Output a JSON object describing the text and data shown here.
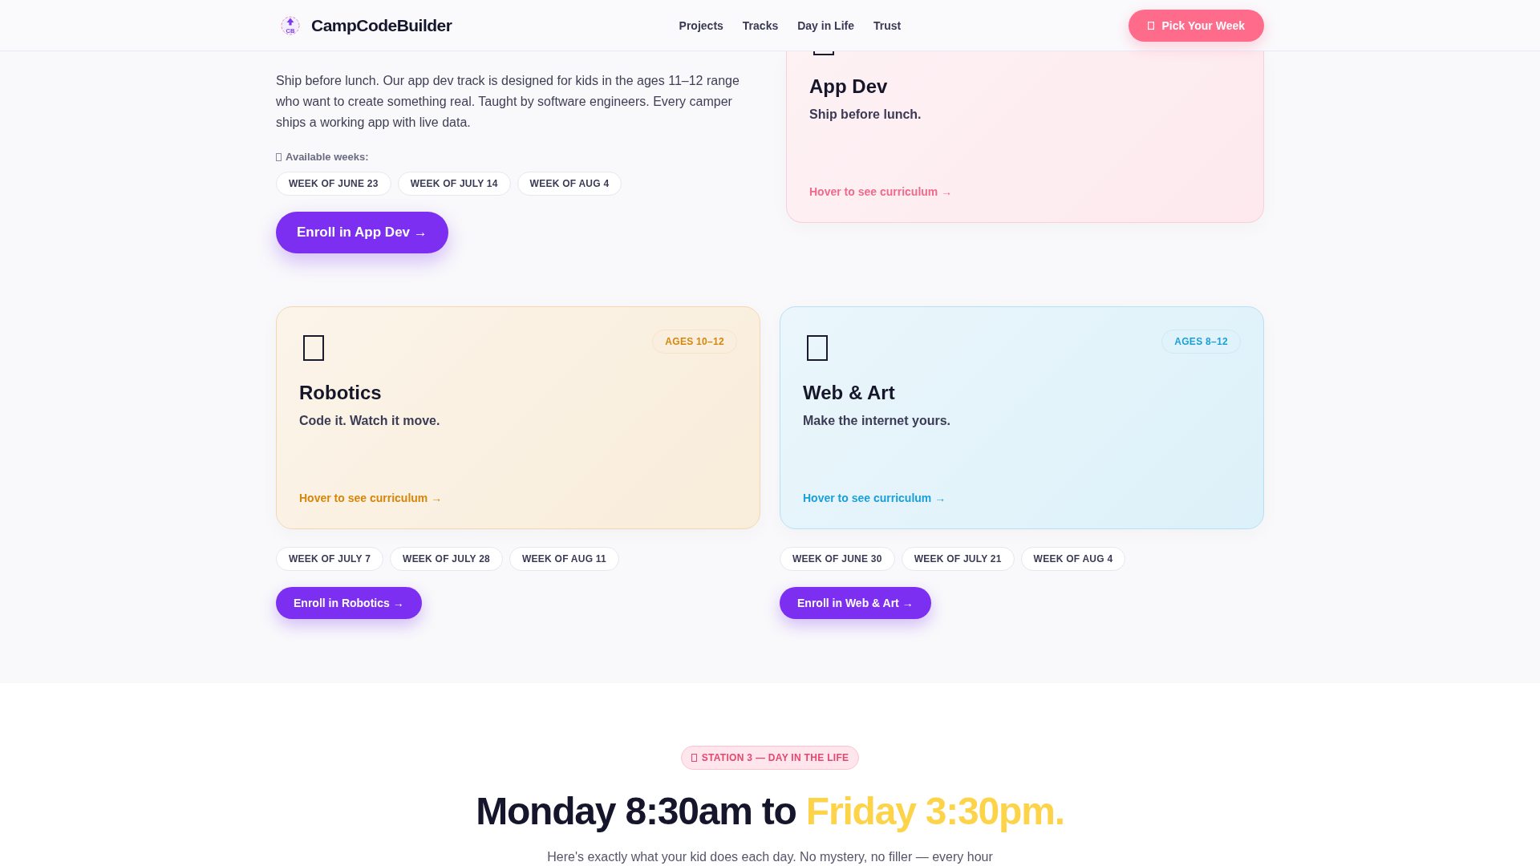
{
  "header": {
    "logo_text": "CB",
    "brand": "CampCodeBuilder",
    "nav": [
      {
        "label": "Projects"
      },
      {
        "label": "Tracks"
      },
      {
        "label": "Day in Life"
      },
      {
        "label": "Trust"
      }
    ],
    "cta": "Pick Your Week"
  },
  "tracks": [
    {
      "kind": "featured",
      "color": "#ef6a8c",
      "description": "Ship before lunch. Our app dev track is designed for kids in the ages 11–12 range who want to create something real. Taught by software engineers. Every camper ships a working app with live data.",
      "weeks_label": "Available weeks:",
      "weeks": [
        "WEEK OF JUNE 23",
        "WEEK OF JULY 14",
        "WEEK OF AUG 4"
      ],
      "enroll": "Enroll in App Dev →",
      "title": "App Dev",
      "tagline": "Ship before lunch.",
      "link": "Hover to see curriculum →"
    },
    {
      "kind": "card",
      "color": "#d6860a",
      "title": "Robotics",
      "age": "AGES 10–12",
      "tagline": "Code it. Watch it move.",
      "link": "Hover to see curriculum →",
      "weeks": [
        "WEEK OF JULY 7",
        "WEEK OF JULY 28",
        "WEEK OF AUG 11"
      ],
      "enroll": "Enroll in Robotics →"
    },
    {
      "kind": "card",
      "color": "#1a9fd8",
      "title": "Web & Art",
      "age": "AGES 8–12",
      "tagline": "Make the internet yours.",
      "link": "Hover to see curriculum →",
      "weeks": [
        "WEEK OF JUNE 30",
        "WEEK OF JULY 21",
        "WEEK OF AUG 4"
      ],
      "enroll": "Enroll in Web & Art →"
    }
  ],
  "day_in_life": {
    "badge": "STATION 3 — DAY IN THE LIFE",
    "heading": "Monday 8:30am to",
    "heading_highlight": "Friday 3:30pm.",
    "intro": "Here's exactly what your kid does each day. No mystery, no filler — every hour"
  }
}
